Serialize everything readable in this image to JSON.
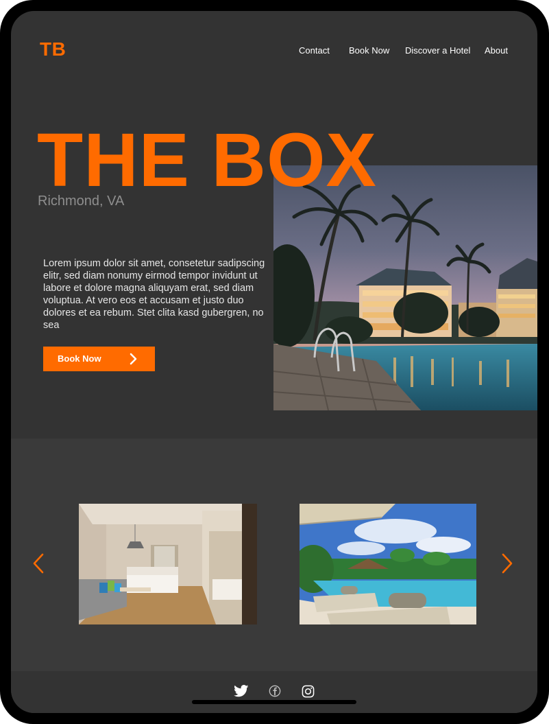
{
  "nav": {
    "logo": "TB",
    "links": [
      "Contact",
      "Book Now",
      "Discover a Hotel",
      "About"
    ]
  },
  "hero": {
    "title": "THE BOX",
    "location": "Richmond, VA",
    "description": "Lorem ipsum dolor sit amet, consetetur sadipscing elitr, sed diam nonumy eirmod tempor invidunt ut labore et dolore magna aliquyam erat, sed diam voluptua. At vero eos et accusam et justo duo dolores et ea rebum. Stet clita kasd gubergren, no sea",
    "button_label": "Book Now",
    "button_icon": "chevron-right-icon"
  },
  "gallery": {
    "prev_icon": "chevron-left-icon",
    "next_icon": "chevron-right-icon"
  },
  "footer": {
    "social_icons": [
      "twitter-icon",
      "facebook-icon",
      "instagram-icon"
    ]
  },
  "colors": {
    "accent": "#ff6b00",
    "background": "#333333",
    "gallery_band": "#3a3a3a",
    "text_light": "#ffffff",
    "muted_text": "#8e8e8e"
  }
}
